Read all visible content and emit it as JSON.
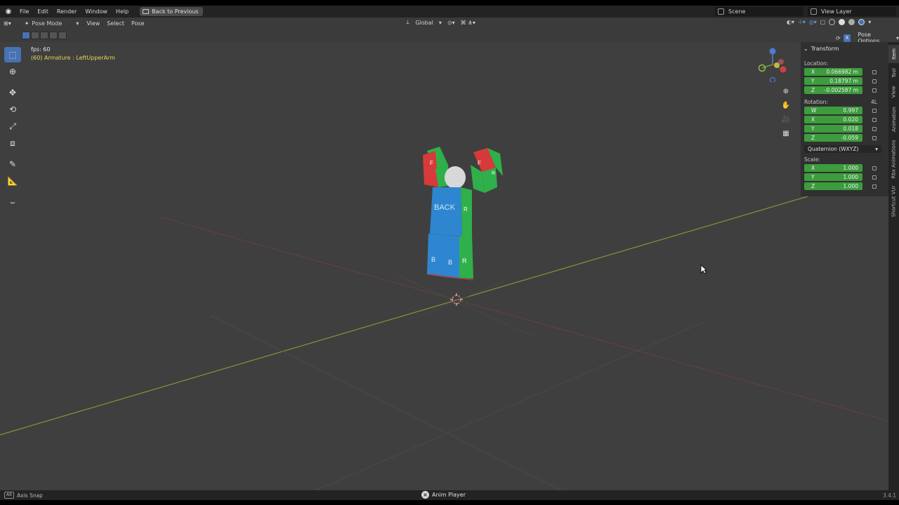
{
  "topbar": {
    "menu": [
      "File",
      "Edit",
      "Render",
      "Window",
      "Help"
    ],
    "back_button": "Back to Previous",
    "scene": "Scene",
    "view_layer": "View Layer"
  },
  "header": {
    "mode": "Pose Mode",
    "menu": [
      "View",
      "Select",
      "Pose"
    ],
    "orientation": "Global"
  },
  "subheader": {
    "pose_options": "Pose Options"
  },
  "viewport": {
    "fps": "fps: 60",
    "bone_info": "(60) Armature : LeftUpperArm"
  },
  "toolbar": {
    "tools": [
      "select-box",
      "cursor",
      "move",
      "rotate",
      "scale",
      "transform",
      "annotate",
      "measure",
      "pose-relax"
    ]
  },
  "npanel": {
    "section": "Transform",
    "location_label": "Location:",
    "location": [
      {
        "axis": "X",
        "value": "0.066982 m"
      },
      {
        "axis": "Y",
        "value": "0.18797 m"
      },
      {
        "axis": "Z",
        "value": "-0.002587 m"
      }
    ],
    "rotation_label": "Rotation:",
    "rotation_mode_short": "4L",
    "rotation": [
      {
        "axis": "W",
        "value": "0.997"
      },
      {
        "axis": "X",
        "value": "0.020"
      },
      {
        "axis": "Y",
        "value": "0.018"
      },
      {
        "axis": "Z",
        "value": "-0.059"
      }
    ],
    "rotation_mode": "Quaternion (WXYZ)",
    "scale_label": "Scale:",
    "scale": [
      {
        "axis": "X",
        "value": "1.000"
      },
      {
        "axis": "Y",
        "value": "1.000"
      },
      {
        "axis": "Z",
        "value": "1.000"
      }
    ]
  },
  "vtabs": [
    "Item",
    "Tool",
    "View",
    "Animation",
    "Rbx Animations",
    "Shortcut VUr"
  ],
  "status": {
    "key": "Alt",
    "axis_snap": "Axis Snap",
    "anim_player": "Anim Player",
    "version": "3.4.1"
  },
  "colors": {
    "field_green": "#3d9c3d",
    "active_blue": "#4772b3",
    "axis_red": "#b84040",
    "axis_green": "#7a9a3a",
    "bone_text": "#e6d85a"
  },
  "character_labels": [
    "BACK",
    "R",
    "B",
    "B",
    "R",
    "F",
    "F",
    "R",
    "R"
  ]
}
